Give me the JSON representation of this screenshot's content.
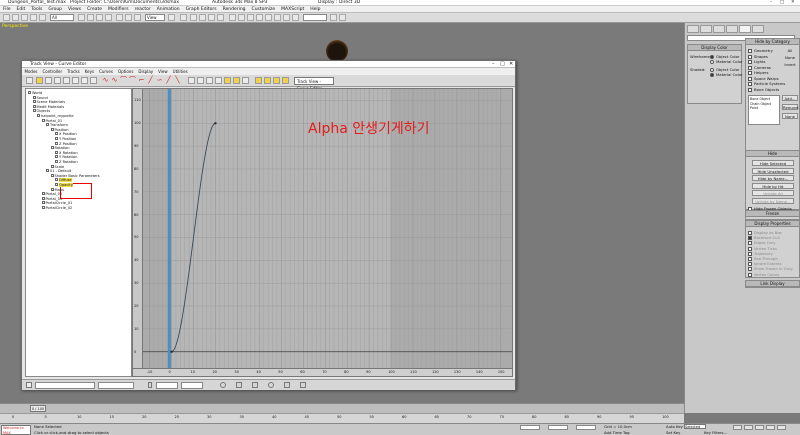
{
  "window": {
    "title_file": "Dungeon_Portal_Test.max",
    "title_project": "Project Folder: C:\\Users\\Kim\\Documents\\3dsmax",
    "title_app": "Autodesk 3ds Max 8 SP3",
    "title_display": "Display : Direct 3D"
  },
  "menu": [
    "File",
    "Edit",
    "Tools",
    "Group",
    "Views",
    "Create",
    "Modifiers",
    "reactor",
    "Animation",
    "Graph Editors",
    "Rendering",
    "Customize",
    "MAXScript",
    "Help"
  ],
  "toolbar": {
    "selection_filter": "All",
    "ref_coord": "View",
    "named_sel": ""
  },
  "viewport": {
    "label": "Perspective"
  },
  "overlay_note": "Alpha 안생기게하기",
  "trackview": {
    "title": "Track View - Curve Editor",
    "menu": [
      "Modes",
      "Controller",
      "Tracks",
      "Keys",
      "Curves",
      "Options",
      "Display",
      "View",
      "Utilities"
    ],
    "view_name": "Track View - Curve Editor",
    "tree": [
      {
        "label": "World",
        "indent": 0
      },
      {
        "label": "Sound",
        "indent": 1
      },
      {
        "label": "Scene Materials",
        "indent": 1
      },
      {
        "label": "Medit Materials",
        "indent": 1
      },
      {
        "label": "Objects",
        "indent": 1
      },
      {
        "label": "halpoint_myportle",
        "indent": 2
      },
      {
        "label": "Portal_01",
        "indent": 3
      },
      {
        "label": "Transform",
        "indent": 4
      },
      {
        "label": "Position",
        "indent": 5
      },
      {
        "label": "X Position",
        "indent": 6
      },
      {
        "label": "Y Position",
        "indent": 6
      },
      {
        "label": "Z Position",
        "indent": 6
      },
      {
        "label": "Rotation",
        "indent": 5
      },
      {
        "label": "X Rotation",
        "indent": 6
      },
      {
        "label": "Y Rotation",
        "indent": 6
      },
      {
        "label": "Z Rotation",
        "indent": 6
      },
      {
        "label": "Scale",
        "indent": 5
      },
      {
        "label": "01 - Default",
        "indent": 4
      },
      {
        "label": "Shader Basic Parameters",
        "indent": 5
      },
      {
        "label": "Diffuse",
        "indent": 6
      },
      {
        "label": "Opacity",
        "indent": 6
      },
      {
        "label": "Maps",
        "indent": 5
      },
      {
        "label": "Portal_02",
        "indent": 3
      },
      {
        "label": "Portal_03",
        "indent": 3
      },
      {
        "label": "PortalCircle_01",
        "indent": 3
      },
      {
        "label": "PortalCircle_02",
        "indent": 3
      }
    ],
    "vruler": [
      "110",
      "100",
      "90",
      "80",
      "70",
      "60",
      "50",
      "40",
      "30",
      "20",
      "10",
      "0"
    ],
    "hruler": [
      "-10",
      "0",
      "10",
      "20",
      "30",
      "40",
      "50",
      "60",
      "70",
      "80",
      "90",
      "100",
      "110",
      "120",
      "130",
      "140",
      "150"
    ],
    "curve_keys": [
      [
        0,
        0
      ],
      [
        20,
        100
      ]
    ],
    "time_cursor": -1
  },
  "command_panel": {
    "hide_by_category": "Hide by Category",
    "categories": [
      "Geometry",
      "Shapes",
      "Lights",
      "Cameras",
      "Helpers",
      "Space Warps",
      "Particle Systems",
      "Bone Objects"
    ],
    "category_buttons": [
      "All",
      "None",
      "Invert"
    ],
    "display_color": "Display Color",
    "wireframe": "Wireframe:",
    "shaded": "Shaded:",
    "object_color": "Object Color",
    "material_color": "Material Color",
    "list_items": [
      "Bone Object",
      "Chain Object",
      "Point"
    ],
    "list_buttons": [
      "Add...",
      "Remove",
      "None"
    ],
    "hide": "Hide",
    "hide_buttons": [
      "Hide Selected",
      "Hide Unselected",
      "Hide by Name...",
      "Hide by Hit",
      "Unhide All",
      "Unhide by Name..."
    ],
    "hide_frozen": "Hide Frozen Objects",
    "freeze": "Freeze",
    "display_properties": "Display Properties",
    "props": [
      "Display as Box",
      "Backface Cull",
      "Edges Only",
      "Vertex Ticks",
      "Trajectory",
      "See-Through",
      "Ignore Extents",
      "Show Frozen in Gray",
      "Vertex Colors"
    ],
    "link_display": "Link Display"
  },
  "timeline": {
    "slider": "0 / 100",
    "ticks": [
      "0",
      "5",
      "10",
      "15",
      "20",
      "25",
      "30",
      "35",
      "40",
      "45",
      "50",
      "55",
      "60",
      "65",
      "70",
      "75",
      "80",
      "85",
      "90",
      "95",
      "100"
    ]
  },
  "status": {
    "maxscript": "Welcome to MAX",
    "none_selected": "None Selected",
    "prompt": "Click or click-and-drag to select objects",
    "grid": "Grid = 10.0cm",
    "add_time_tag": "Add Time Tag",
    "autokey": "Auto Key",
    "setkey": "Set Key",
    "selected": "Selected",
    "key_filters": "Key Filters..."
  },
  "colors": {
    "overlay": "#e41c1c",
    "highlight": "#f3e04e",
    "time_cursor": "#4a8fc2",
    "curve": "#3a4a5a"
  }
}
